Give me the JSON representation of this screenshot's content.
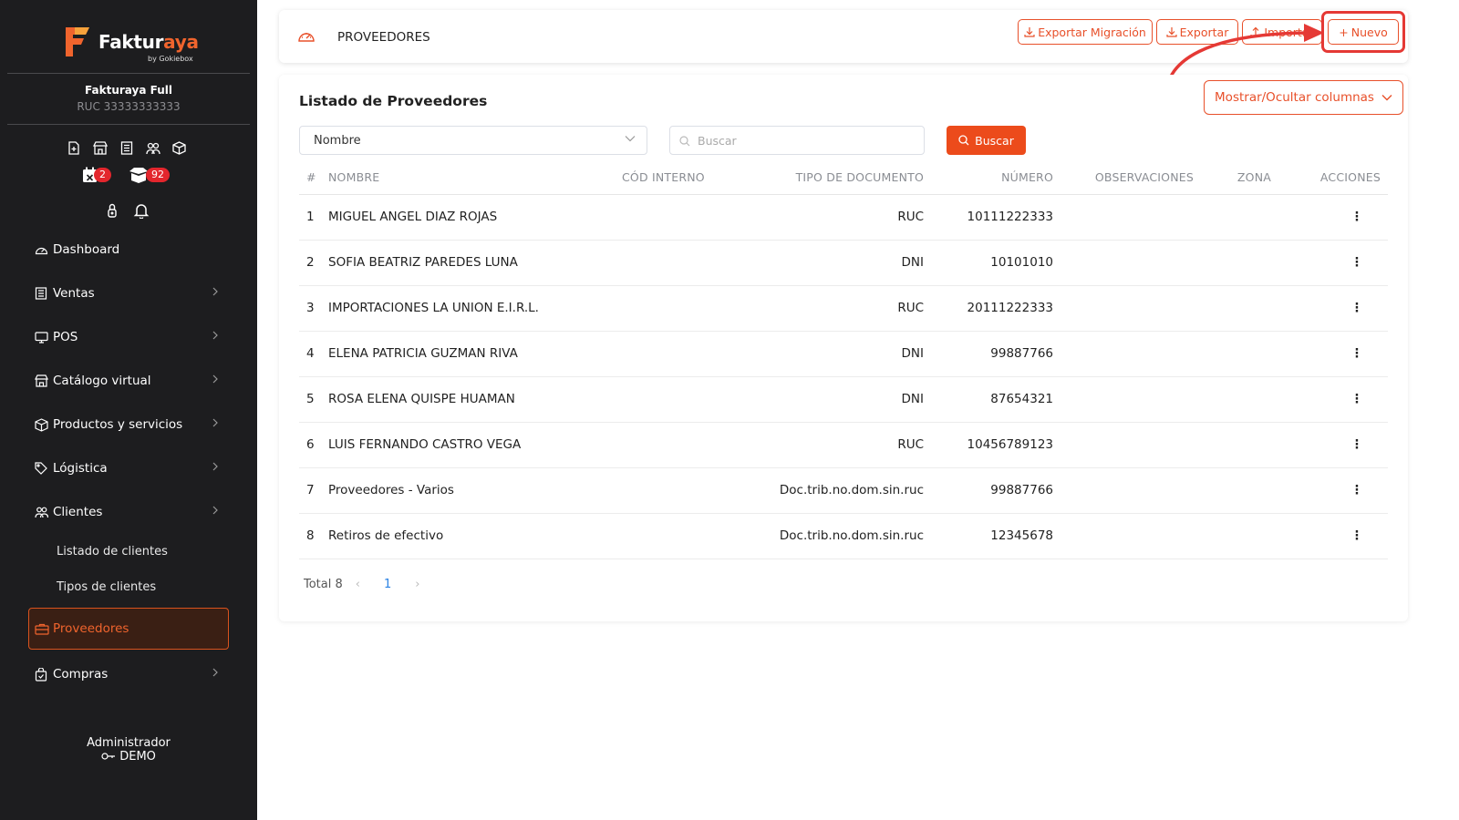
{
  "sidebar": {
    "brand_main": "Faktur",
    "brand_accent": "aya",
    "brand_sub": "by Gokiebox",
    "company": "Fakturaya Full",
    "ruc": "RUC 33333333333",
    "badge_calendar": "2",
    "badge_box": "92",
    "nav": [
      {
        "label": "Dashboard"
      },
      {
        "label": "Ventas"
      },
      {
        "label": "POS"
      },
      {
        "label": "Catálogo virtual"
      },
      {
        "label": "Productos y servicios"
      },
      {
        "label": "Lógistica"
      },
      {
        "label": "Clientes"
      },
      {
        "label": "Proveedores"
      },
      {
        "label": "Compras"
      }
    ],
    "sub_clientes": [
      "Listado de clientes",
      "Tipos de clientes"
    ],
    "user_role": "Administrador",
    "user_name": "DEMO"
  },
  "header": {
    "title": "PROVEEDORES",
    "btn_export_migration": "Exportar Migración",
    "btn_export": "Exportar",
    "btn_import": "Importar",
    "btn_new": "Nuevo"
  },
  "listado": {
    "title": "Listado de Proveedores",
    "cols_button": "Mostrar/Ocultar columnas",
    "filter_select": "Nombre",
    "search_placeholder": "Buscar",
    "search_button": "Buscar",
    "columns": [
      "#",
      "NOMBRE",
      "CÓD INTERNO",
      "TIPO DE DOCUMENTO",
      "NÚMERO",
      "OBSERVACIONES",
      "ZONA",
      "ACCIONES"
    ],
    "rows": [
      {
        "n": "1",
        "nombre": "MIGUEL ANGEL DIAZ ROJAS",
        "cod": "",
        "tipo": "RUC",
        "numero": "10111222333",
        "obs": "",
        "zona": ""
      },
      {
        "n": "2",
        "nombre": "SOFIA BEATRIZ PAREDES LUNA",
        "cod": "",
        "tipo": "DNI",
        "numero": "10101010",
        "obs": "",
        "zona": ""
      },
      {
        "n": "3",
        "nombre": "IMPORTACIONES LA UNION E.I.R.L.",
        "cod": "",
        "tipo": "RUC",
        "numero": "20111222333",
        "obs": "",
        "zona": ""
      },
      {
        "n": "4",
        "nombre": "ELENA PATRICIA GUZMAN RIVA",
        "cod": "",
        "tipo": "DNI",
        "numero": "99887766",
        "obs": "",
        "zona": ""
      },
      {
        "n": "5",
        "nombre": "ROSA ELENA QUISPE HUAMAN",
        "cod": "",
        "tipo": "DNI",
        "numero": "87654321",
        "obs": "",
        "zona": ""
      },
      {
        "n": "6",
        "nombre": "LUIS FERNANDO CASTRO VEGA",
        "cod": "",
        "tipo": "RUC",
        "numero": "10456789123",
        "obs": "",
        "zona": ""
      },
      {
        "n": "7",
        "nombre": "Proveedores - Varios",
        "cod": "",
        "tipo": "Doc.trib.no.dom.sin.ruc",
        "numero": "99887766",
        "obs": "",
        "zona": ""
      },
      {
        "n": "8",
        "nombre": "Retiros de efectivo",
        "cod": "",
        "tipo": "Doc.trib.no.dom.sin.ruc",
        "numero": "12345678",
        "obs": "",
        "zona": ""
      }
    ],
    "total_label": "Total 8",
    "current_page": "1"
  },
  "colors": {
    "accent": "#ec4b1b",
    "sidebar_bg": "#1d1d1f",
    "annotation": "#e53935"
  }
}
